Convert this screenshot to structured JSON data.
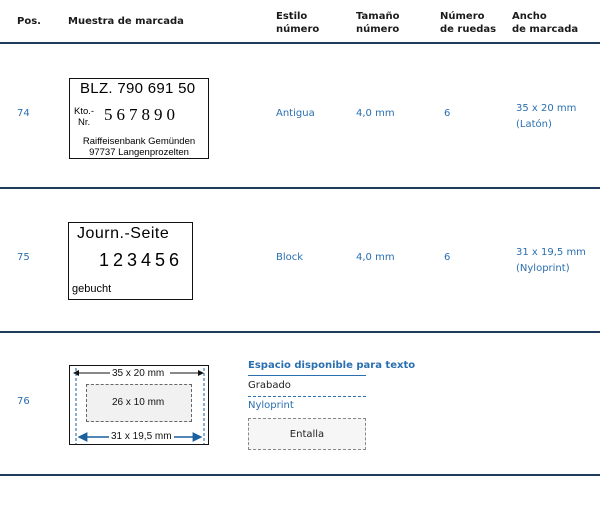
{
  "headers": {
    "pos": "Pos.",
    "sample": "Muestra de marcada",
    "style_line1": "Estilo",
    "style_line2": "número",
    "size_line1": "Tamaño",
    "size_line2": "número",
    "wheels_line1": "Número",
    "wheels_line2": "de ruedas",
    "width_line1": "Ancho",
    "width_line2": "de marcada"
  },
  "rows": [
    {
      "pos": "74",
      "style": "Antigua",
      "size": "4,0 mm",
      "wheels": "6",
      "width_line1": "35 x 20 mm",
      "width_line2": "(Latón)",
      "stamp": {
        "title": "BLZ. 790 691 50",
        "kto_line1": "Kto.-",
        "kto_line2": "Nr.",
        "number": "567890",
        "bank": "Raiffeisenbank Gemünden",
        "city": "97737 Langenprozelten"
      }
    },
    {
      "pos": "75",
      "style": "Block",
      "size": "4,0 mm",
      "wheels": "6",
      "width_line1": "31 x 19,5 mm",
      "width_line2": "(Nyloprint)",
      "stamp": {
        "title": "Journ.-Seite",
        "number": "123456",
        "sub": "gebucht"
      }
    },
    {
      "pos": "76",
      "diagram": {
        "outer_label": "35 x 20 mm",
        "inner_label": "26 x 10 mm",
        "bottom_label": "31 x 19,5 mm"
      },
      "text_space": {
        "title": "Espacio disponible para texto",
        "engraved": "Grabado",
        "nyloprint": "Nyloprint",
        "box": "Entalla"
      }
    }
  ],
  "colors": {
    "accent": "#2a6fb0",
    "rule": "#1f3b5c"
  }
}
